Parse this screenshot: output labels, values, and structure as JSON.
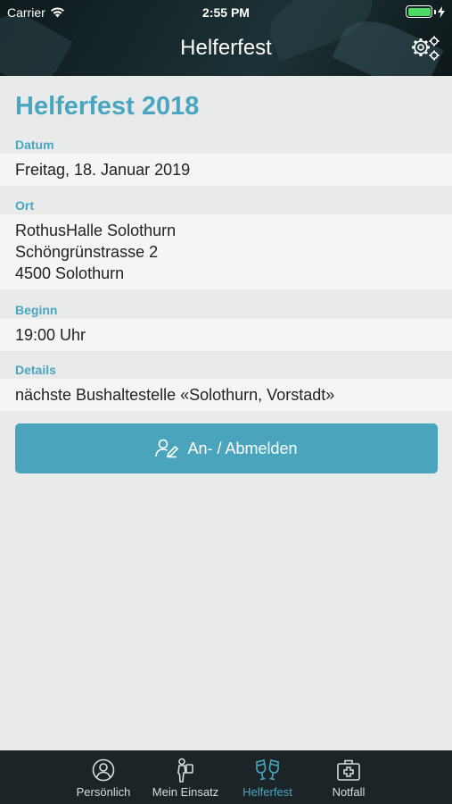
{
  "status_bar": {
    "carrier": "Carrier",
    "time": "2:55 PM"
  },
  "nav": {
    "title": "Helferfest",
    "settings_icon": "gears-icon"
  },
  "event": {
    "title": "Helferfest 2018",
    "date_label": "Datum",
    "date_value": "Freitag, 18. Januar 2019",
    "place_label": "Ort",
    "place_lines": [
      "RothusHalle Solothurn",
      "Schöngrünstrasse 2",
      "4500 Solothurn"
    ],
    "start_label": "Beginn",
    "start_value": "19:00 Uhr",
    "details_label": "Details",
    "details_value": "nächste Bushaltestelle «Solothurn, Vorstadt»"
  },
  "action": {
    "label": "An- / Abmelden",
    "icon": "user-edit-icon"
  },
  "colors": {
    "accent": "#4aa6c0",
    "button": "#4aa4bc",
    "tabbar": "#1b2527"
  },
  "tabs": [
    {
      "label": "Persönlich",
      "icon": "person-circle-icon",
      "active": false
    },
    {
      "label": "Mein Einsatz",
      "icon": "worker-icon",
      "active": false
    },
    {
      "label": "Helferfest",
      "icon": "toast-glasses-icon",
      "active": true
    },
    {
      "label": "Notfall",
      "icon": "first-aid-icon",
      "active": false
    }
  ]
}
